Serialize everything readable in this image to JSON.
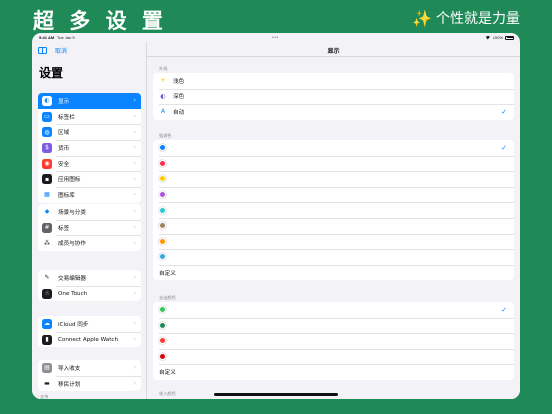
{
  "banner": {
    "title": "超 多 设 置",
    "slogan": "个性就是力量",
    "sparkle": "✨"
  },
  "statusbar": {
    "time": "9:41 AM",
    "date": "Tue Jan 9",
    "battery": "100%",
    "dots": "•••"
  },
  "sidebar": {
    "cancel": "取消",
    "title": "设置",
    "groups": [
      [
        {
          "label": "显示",
          "icon": "display-icon",
          "color": "#0a84ff",
          "glyph": "◐",
          "active": true
        },
        {
          "label": "标签栏",
          "icon": "tab-bar-icon",
          "color": "#0a84ff",
          "glyph": "▭"
        },
        {
          "label": "区域",
          "icon": "globe-icon",
          "color": "#0a84ff",
          "glyph": "◍"
        },
        {
          "label": "货币",
          "icon": "currency-icon",
          "color": "#7d5ce0",
          "glyph": "$"
        },
        {
          "label": "安全",
          "icon": "security-icon",
          "color": "#ff3b30",
          "glyph": "◉"
        },
        {
          "label": "应用图标",
          "icon": "app-icon-icon",
          "color": "#1c1c1e",
          "glyph": "▪"
        },
        {
          "label": "图标库",
          "icon": "icon-library-icon",
          "color": "#0a84ff",
          "glyph": "▦",
          "bg": "#ffffff"
        }
      ],
      [
        {
          "label": "场景与分类",
          "icon": "scene-category-icon",
          "color": "#0a84ff",
          "glyph": "◆",
          "bg": "#ffffff"
        },
        {
          "label": "标签",
          "icon": "tag-icon",
          "color": "#636366",
          "glyph": "#"
        },
        {
          "label": "成员与协作",
          "icon": "members-icon",
          "color": "#1c1c1e",
          "glyph": "⁂",
          "bg": "#ffffff"
        }
      ],
      [
        {
          "label": "交易编辑器",
          "icon": "transaction-editor-icon",
          "color": "#1c1c1e",
          "glyph": "✎",
          "bg": "#ffffff"
        },
        {
          "label": "One Touch",
          "icon": "one-touch-icon",
          "color": "#1c1c1e",
          "glyph": "☝"
        }
      ],
      [
        {
          "label": "iCloud 同步",
          "icon": "icloud-icon",
          "color": "#0a84ff",
          "glyph": "☁"
        },
        {
          "label": "Connect Apple Watch",
          "icon": "apple-watch-icon",
          "color": "#1c1c1e",
          "glyph": "▮"
        }
      ],
      [
        {
          "label": "导入收支",
          "icon": "import-icon",
          "color": "#8e8e93",
          "glyph": "▤"
        },
        {
          "label": "移民计划",
          "icon": "migration-icon",
          "color": "#1c1c1e",
          "glyph": "▬",
          "bg": "#ffffff"
        }
      ]
    ],
    "footer_label": "支持"
  },
  "main": {
    "title": "显示",
    "appearance": {
      "label": "外观",
      "options": [
        {
          "label": "浅色",
          "glyph": "☀",
          "icon": "sun-icon",
          "color": "#ffcc00"
        },
        {
          "label": "深色",
          "glyph": "◐",
          "icon": "moon-icon",
          "color": "#5856d6"
        },
        {
          "label": "自动",
          "glyph": "A",
          "icon": "auto-icon",
          "color": "#0a84ff",
          "checked": true
        }
      ]
    },
    "theme": {
      "label": "强调色",
      "colors": [
        "#0a84ff",
        "#ff2d55",
        "#ffcc00",
        "#af52de",
        "#30c8d6",
        "#a2845e",
        "#ff9500",
        "#34aadc"
      ],
      "checked_index": 0,
      "custom": "自定义"
    },
    "income": {
      "label": "支出颜色",
      "colors": [
        "#34c759",
        "#1f8a57",
        "#ff3b30",
        "#d70015"
      ],
      "checked_index": 0,
      "custom": "自定义"
    },
    "bottom_label": "收入颜色"
  }
}
